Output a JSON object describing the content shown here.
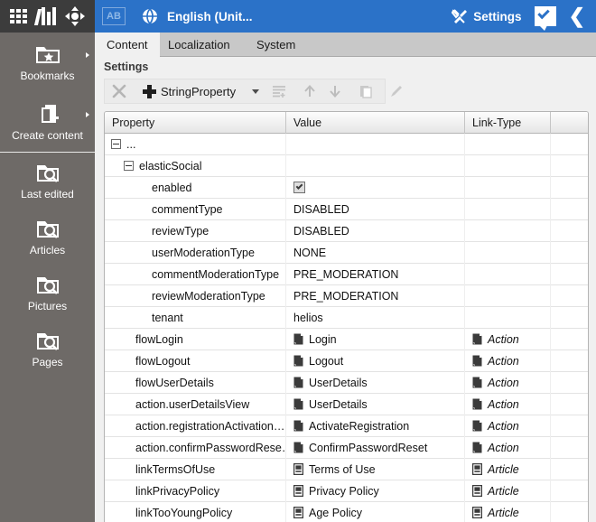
{
  "window": {
    "app_icons": [
      "grid-icon",
      "books-icon",
      "move-icon"
    ],
    "lang_badge": "AB",
    "title": "English (Unit...",
    "settings_label": "Settings",
    "icons": [
      "globe-icon",
      "wrench-icon",
      "chat-check-icon",
      "chevron-left-icon"
    ]
  },
  "sidebar": {
    "items": [
      {
        "label": "Bookmarks",
        "icon": "folder-star-icon",
        "has_arrow": true
      },
      {
        "label": "Create content",
        "icon": "page-plus-icon",
        "has_arrow": true
      },
      {
        "label": "Last edited",
        "icon": "folder-search-icon",
        "has_arrow": false
      },
      {
        "label": "Articles",
        "icon": "folder-search-icon",
        "has_arrow": false
      },
      {
        "label": "Pictures",
        "icon": "folder-search-icon",
        "has_arrow": false
      },
      {
        "label": "Pages",
        "icon": "folder-search-icon",
        "has_arrow": false
      }
    ]
  },
  "main": {
    "tabs": [
      {
        "label": "Content",
        "active": true
      },
      {
        "label": "Localization",
        "active": false
      },
      {
        "label": "System",
        "active": false
      }
    ],
    "panel_title": "Settings",
    "toolbar": {
      "delete_label": "",
      "add_label": "StringProperty",
      "buttons": [
        {
          "name": "delete-button",
          "icon": "close-x-icon",
          "enabled": false
        },
        {
          "name": "add-property-button",
          "icon": "plus-icon",
          "enabled": true
        },
        {
          "name": "add-dropdown-button",
          "icon": "chevron-down-icon",
          "enabled": true
        },
        {
          "name": "indent-button",
          "icon": "list-indent-icon",
          "enabled": false
        },
        {
          "name": "move-up-button",
          "icon": "arrow-up-icon",
          "enabled": false
        },
        {
          "name": "move-down-button",
          "icon": "arrow-down-icon",
          "enabled": false
        },
        {
          "name": "copy-button",
          "icon": "copy-icon",
          "enabled": false
        },
        {
          "name": "edit-button",
          "icon": "pencil-icon",
          "enabled": false
        }
      ]
    },
    "table": {
      "columns": [
        "Property",
        "Value",
        "Link-Type",
        ""
      ],
      "rows": [
        {
          "property": "...",
          "indent": 0,
          "expander": true,
          "value": "",
          "value_icon": "",
          "link_type": "",
          "link_icon": "",
          "checkbox": false
        },
        {
          "property": "elasticSocial",
          "indent": 1,
          "expander": true,
          "value": "",
          "value_icon": "",
          "link_type": "",
          "link_icon": "",
          "checkbox": false
        },
        {
          "property": "enabled",
          "indent": 2,
          "expander": false,
          "value": "",
          "value_icon": "",
          "link_type": "",
          "link_icon": "",
          "checkbox": true
        },
        {
          "property": "commentType",
          "indent": 2,
          "expander": false,
          "value": "DISABLED",
          "value_icon": "",
          "link_type": "",
          "link_icon": "",
          "checkbox": false
        },
        {
          "property": "reviewType",
          "indent": 2,
          "expander": false,
          "value": "DISABLED",
          "value_icon": "",
          "link_type": "",
          "link_icon": "",
          "checkbox": false
        },
        {
          "property": "userModerationType",
          "indent": 2,
          "expander": false,
          "value": "NONE",
          "value_icon": "",
          "link_type": "",
          "link_icon": "",
          "checkbox": false
        },
        {
          "property": "commentModerationType",
          "indent": 2,
          "expander": false,
          "value": "PRE_MODERATION",
          "value_icon": "",
          "link_type": "",
          "link_icon": "",
          "checkbox": false
        },
        {
          "property": "reviewModerationType",
          "indent": 2,
          "expander": false,
          "value": "PRE_MODERATION",
          "value_icon": "",
          "link_type": "",
          "link_icon": "",
          "checkbox": false
        },
        {
          "property": "tenant",
          "indent": 2,
          "expander": false,
          "value": "helios",
          "value_icon": "",
          "link_type": "",
          "link_icon": "",
          "checkbox": false
        },
        {
          "property": "flowLogin",
          "indent": 1,
          "expander": false,
          "value": "Login",
          "value_icon": "action-icon",
          "link_type": "Action",
          "link_icon": "action-icon",
          "checkbox": false
        },
        {
          "property": "flowLogout",
          "indent": 1,
          "expander": false,
          "value": "Logout",
          "value_icon": "action-icon",
          "link_type": "Action",
          "link_icon": "action-icon",
          "checkbox": false
        },
        {
          "property": "flowUserDetails",
          "indent": 1,
          "expander": false,
          "value": "UserDetails",
          "value_icon": "action-icon",
          "link_type": "Action",
          "link_icon": "action-icon",
          "checkbox": false
        },
        {
          "property": "action.userDetailsView",
          "indent": 1,
          "expander": false,
          "value": "UserDetails",
          "value_icon": "action-icon",
          "link_type": "Action",
          "link_icon": "action-icon",
          "checkbox": false
        },
        {
          "property": "action.registrationActivation…",
          "indent": 1,
          "expander": false,
          "value": "ActivateRegistration",
          "value_icon": "action-icon",
          "link_type": "Action",
          "link_icon": "action-icon",
          "checkbox": false
        },
        {
          "property": "action.confirmPasswordRese…",
          "indent": 1,
          "expander": false,
          "value": "ConfirmPasswordReset",
          "value_icon": "action-icon",
          "link_type": "Action",
          "link_icon": "action-icon",
          "checkbox": false
        },
        {
          "property": "linkTermsOfUse",
          "indent": 1,
          "expander": false,
          "value": "Terms of Use",
          "value_icon": "article-icon",
          "link_type": "Article",
          "link_icon": "article-icon",
          "checkbox": false
        },
        {
          "property": "linkPrivacyPolicy",
          "indent": 1,
          "expander": false,
          "value": "Privacy Policy",
          "value_icon": "article-icon",
          "link_type": "Article",
          "link_icon": "article-icon",
          "checkbox": false
        },
        {
          "property": "linkTooYoungPolicy",
          "indent": 1,
          "expander": false,
          "value": "Age Policy",
          "value_icon": "article-icon",
          "link_type": "Article",
          "link_icon": "article-icon",
          "checkbox": false
        }
      ]
    }
  },
  "colors": {
    "accent_blue": "#2b72c8",
    "dark_bar": "#3c3c3c",
    "sidebar_gray": "#6e6a67",
    "tab_gray": "#c8c8c8",
    "panel_gray": "#f0f0f0"
  }
}
